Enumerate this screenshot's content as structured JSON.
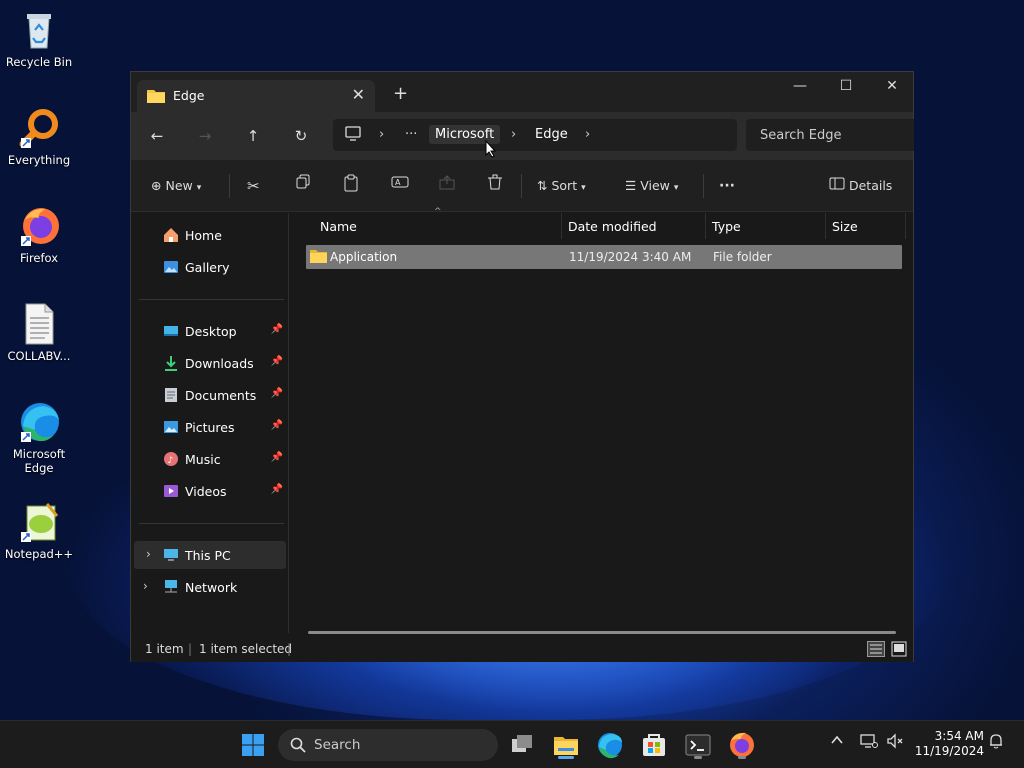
{
  "desktop": {
    "icons": [
      {
        "label": "Recycle Bin"
      },
      {
        "label": "Everything"
      },
      {
        "label": "Firefox"
      },
      {
        "label": "COLLABV..."
      },
      {
        "label": "Microsoft Edge"
      },
      {
        "label": "Notepad++"
      }
    ]
  },
  "window": {
    "tab_title": "Edge",
    "tab_close": "✕",
    "new_tab": "+",
    "controls": {
      "minimize": "—",
      "maximize": "☐",
      "close": "✕"
    },
    "nav": {
      "breadcrumb": [
        "Microsoft",
        "Edge"
      ],
      "ellipsis": "···",
      "search_placeholder": "Search Edge"
    },
    "toolbar": {
      "new_label": "New",
      "sort_label": "Sort",
      "view_label": "View",
      "more_label": "···",
      "details_label": "Details"
    },
    "sidebar": {
      "quick": [
        {
          "label": "Home"
        },
        {
          "label": "Gallery"
        }
      ],
      "pinned": [
        {
          "label": "Desktop"
        },
        {
          "label": "Downloads"
        },
        {
          "label": "Documents"
        },
        {
          "label": "Pictures"
        },
        {
          "label": "Music"
        },
        {
          "label": "Videos"
        }
      ],
      "tree": [
        {
          "label": "This PC"
        },
        {
          "label": "Network"
        }
      ]
    },
    "columns": [
      "Name",
      "Date modified",
      "Type",
      "Size"
    ],
    "files": [
      {
        "name": "Application",
        "date": "11/19/2024 3:40 AM",
        "type": "File folder",
        "size": ""
      }
    ],
    "status": {
      "count": "1 item",
      "selected": "1 item selected"
    }
  },
  "taskbar": {
    "search_label": "Search",
    "time": "3:54 AM",
    "date": "11/19/2024"
  },
  "colors": {
    "selection": "#777777",
    "window_bg": "#191919",
    "accent": "#3a8ee6"
  }
}
